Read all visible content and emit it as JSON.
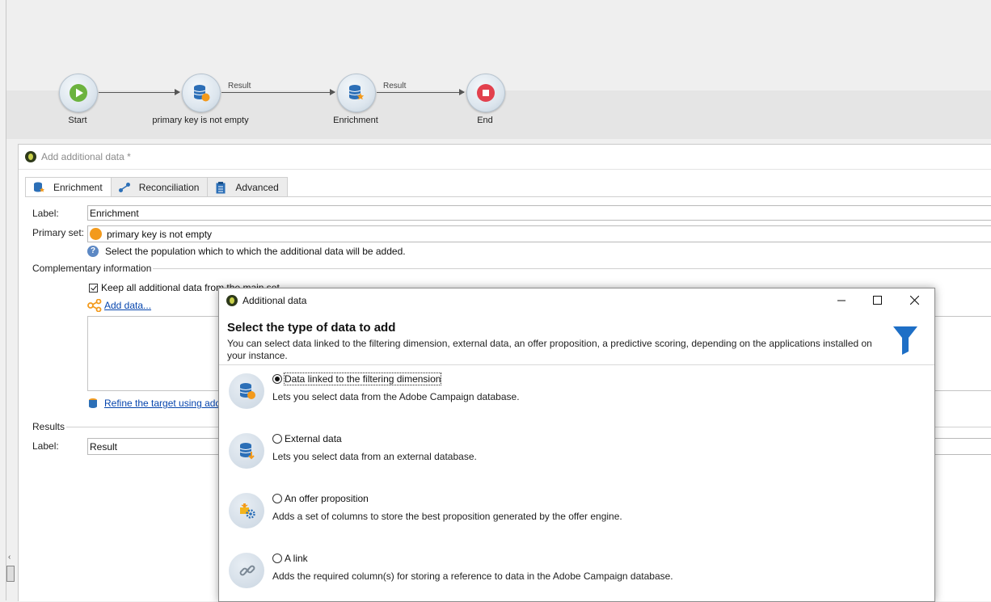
{
  "workflow": {
    "nodes": [
      {
        "label": "Start",
        "icon": "play-icon"
      },
      {
        "label": "primary key is not empty",
        "icon": "database-query-icon"
      },
      {
        "label": "Enrichment",
        "icon": "database-enrichment-icon"
      },
      {
        "label": "End",
        "icon": "stop-icon"
      }
    ],
    "edge_labels": [
      "Result",
      "Result"
    ]
  },
  "editor": {
    "title": "Add additional data *",
    "tabs": [
      {
        "label": "Enrichment",
        "icon": "enrichment-icon"
      },
      {
        "label": "Reconciliation",
        "icon": "reconciliation-icon"
      },
      {
        "label": "Advanced",
        "icon": "clipboard-icon"
      }
    ],
    "label_caption": "Label:",
    "label_value": "Enrichment",
    "primary_set_caption": "Primary set:",
    "primary_set_value": "primary key is not empty",
    "primary_set_help": "Select the population which to which the additional data will be added.",
    "complementary_title": "Complementary information",
    "keep_all_label": "Keep all additional data from the main set",
    "keep_all_checked": true,
    "add_data_link": "Add data...",
    "refine_link": "Refine the target using add",
    "results_title": "Results",
    "results_label_caption": "Label:",
    "results_label_value": "Result"
  },
  "dialog": {
    "title": "Additional data",
    "heading": "Select the type of data to add",
    "description": "You can select data linked to the filtering dimension, external data, an offer proposition, a predictive scoring, depending on the applications installed on your instance.",
    "options": [
      {
        "label": "Data linked to the filtering dimension",
        "description": "Lets you select data from the Adobe Campaign database.",
        "selected": true,
        "icon": "database-linked-icon"
      },
      {
        "label": "External data",
        "description": "Lets you select data from an external database.",
        "selected": false,
        "icon": "external-database-icon"
      },
      {
        "label": "An offer proposition",
        "description": "Adds a set of columns to store the best proposition generated by the offer engine.",
        "selected": false,
        "icon": "offer-icon"
      },
      {
        "label": "A link",
        "description": "Adds the required column(s) for storing a reference to data in the Adobe Campaign database.",
        "selected": false,
        "icon": "link-icon"
      }
    ],
    "colors": {
      "accent": "#1f73c4",
      "funnel": "#1e6fc6"
    }
  }
}
